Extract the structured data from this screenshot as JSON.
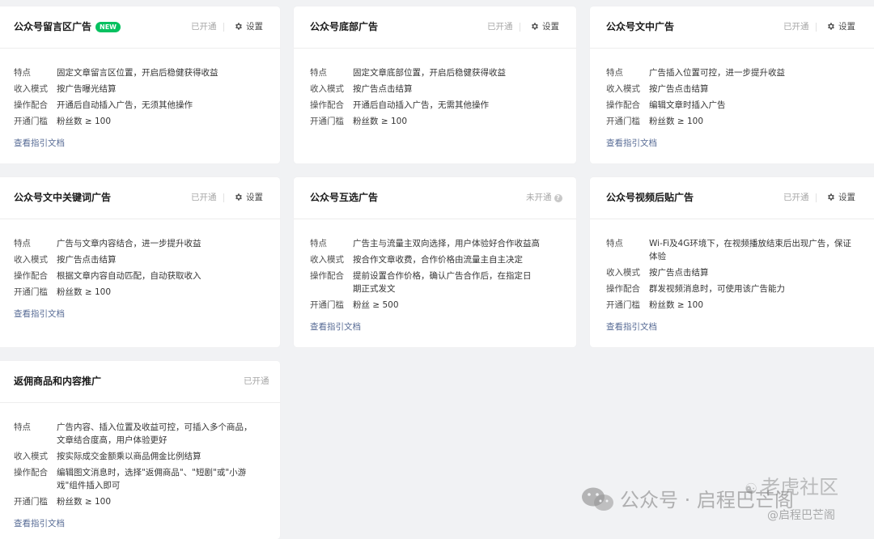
{
  "field_labels": {
    "feature": "特点",
    "revenue": "收入模式",
    "operation": "操作配合",
    "threshold": "开通门槛"
  },
  "settings_label": "设置",
  "doc_link_label": "查看指引文档",
  "cards": [
    {
      "title": "公众号留言区广告",
      "badge": "NEW",
      "status": "已开通",
      "feature": "固定文章留言区位置，开启后稳健获得收益",
      "revenue": "按广告曝光结算",
      "operation": "开通后自动插入广告，无须其他操作",
      "threshold": "粉丝数 ≥ 100"
    },
    {
      "title": "公众号底部广告",
      "status": "已开通",
      "feature": "固定文章底部位置，开启后稳健获得收益",
      "revenue": "按广告点击结算",
      "operation": "开通后自动插入广告，无需其他操作",
      "threshold": "粉丝数 ≥ 100"
    },
    {
      "title": "公众号文中广告",
      "status": "已开通",
      "feature": "广告插入位置可控，进一步提升收益",
      "revenue": "按广告点击结算",
      "operation": "编辑文章时插入广告",
      "threshold": "粉丝数 ≥ 100"
    },
    {
      "title": "公众号文中关键词广告",
      "status": "已开通",
      "feature": "广告与文章内容结合，进一步提升收益",
      "revenue": "按广告点击结算",
      "operation": "根据文章内容自动匹配，自动获取收入",
      "threshold": "粉丝数 ≥ 100"
    },
    {
      "title": "公众号互选广告",
      "status": "未开通",
      "feature": "广告主与流量主双向选择，用户体验好合作收益高",
      "revenue": "按合作文章收费，合作价格由流量主自主决定",
      "operation": "提前设置合作价格，确认广告合作后，在指定日期正式发文",
      "threshold": "粉丝 ≥ 500"
    },
    {
      "title": "公众号视频后贴广告",
      "status": "已开通",
      "feature": "Wi-Fi及4G环境下，在视频播放结束后出现广告，保证体验",
      "revenue": "按广告点击结算",
      "operation": "群发视频消息时，可使用该广告能力",
      "threshold": "粉丝数 ≥ 100"
    },
    {
      "title": "返佣商品和内容推广",
      "status": "已开通",
      "feature": "广告内容、插入位置及收益可控，可插入多个商品，文章结合度高，用户体验更好",
      "revenue": "按实际成交金额乘以商品佣金比例结算",
      "operation": "编辑图文消息时，选择\"返佣商品\"、\"短剧\"或\"小游戏\"组件插入即可",
      "threshold": "粉丝数 ≥ 100"
    }
  ],
  "watermark": {
    "brand": "公众号 · 启程巴芒阁",
    "community": "老虎社区",
    "handle": "@启程巴芒阁"
  }
}
